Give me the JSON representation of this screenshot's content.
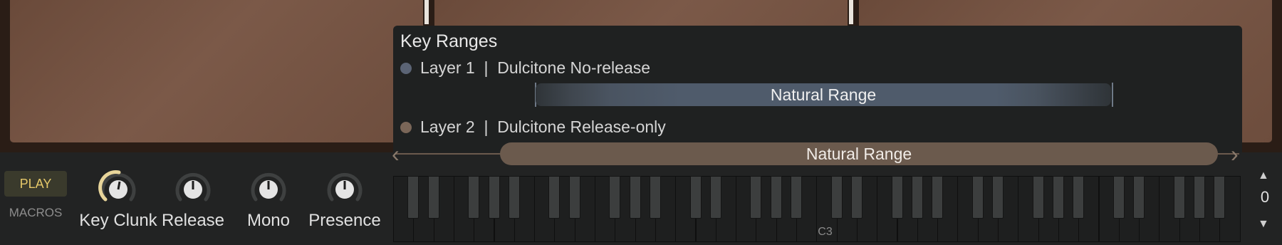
{
  "key_ranges": {
    "title": "Key Ranges",
    "layers": [
      {
        "label": "Layer 1  |  Dulcitone No-release",
        "dot_color": "#5b6475",
        "range_label": "Natural Range",
        "color": "#4f5b6b"
      },
      {
        "label": "Layer 2  |  Dulcitone Release-only",
        "dot_color": "#7a6658",
        "range_label": "Natural Range",
        "color": "#6b5a4d"
      }
    ]
  },
  "macros": {
    "play_label": "PLAY",
    "macros_label": "MACROS",
    "knobs": [
      {
        "label": "Key Clunk",
        "active": true,
        "value": 0.55
      },
      {
        "label": "Release",
        "active": false,
        "value": 0.5
      },
      {
        "label": "Mono",
        "active": false,
        "value": 0.5
      },
      {
        "label": "Presence",
        "active": false,
        "value": 0.5
      }
    ]
  },
  "keyboard": {
    "c3_label": "C3"
  },
  "octave": {
    "up_icon": "triangle-up-icon",
    "value": "0",
    "down_icon": "triangle-down-icon"
  },
  "colors": {
    "accent": "#e5c869",
    "knob_active_arc": "#e8d59a"
  }
}
